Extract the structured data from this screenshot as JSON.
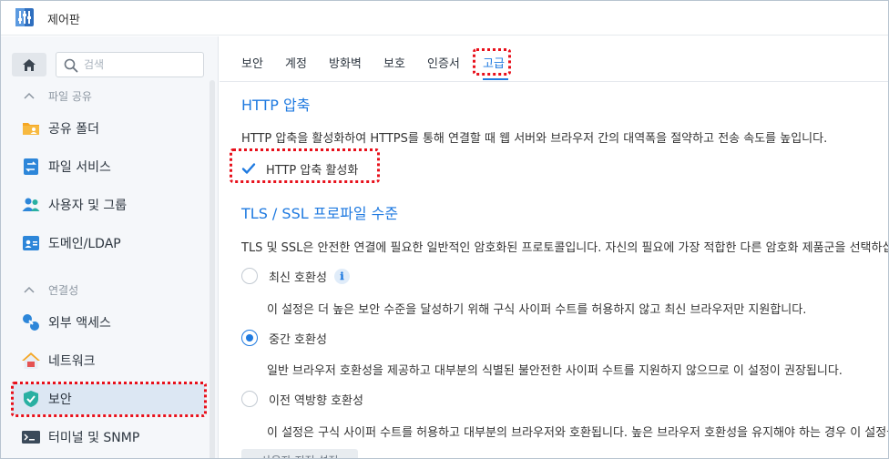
{
  "window": {
    "title": "제어판"
  },
  "sidebar": {
    "search_placeholder": "검색",
    "sections": [
      {
        "label": "파일 공유",
        "items": [
          {
            "label": "공유 폴더",
            "icon": "folder-share-icon"
          },
          {
            "label": "파일 서비스",
            "icon": "file-services-icon"
          },
          {
            "label": "사용자 및 그룹",
            "icon": "users-icon"
          },
          {
            "label": "도메인/LDAP",
            "icon": "domain-icon"
          }
        ]
      },
      {
        "label": "연결성",
        "items": [
          {
            "label": "외부 액세스",
            "icon": "external-access-icon"
          },
          {
            "label": "네트워크",
            "icon": "network-icon"
          },
          {
            "label": "보안",
            "icon": "security-shield-icon",
            "active": true
          },
          {
            "label": "터미널 및 SNMP",
            "icon": "terminal-icon"
          }
        ]
      }
    ]
  },
  "tabs": [
    {
      "label": "보안"
    },
    {
      "label": "계정"
    },
    {
      "label": "방화벽"
    },
    {
      "label": "보호"
    },
    {
      "label": "인증서"
    },
    {
      "label": "고급",
      "active": true
    }
  ],
  "http_compression": {
    "title": "HTTP 압축",
    "description": "HTTP 압축을 활성화하여 HTTPS를 통해 연결할 때 웹 서버와 브라우저 간의 대역폭을 절약하고 전송 속도를 높입니다.",
    "checkbox_label": "HTTP 압축 활성화",
    "checked": true
  },
  "tls_profile": {
    "title": "TLS / SSL 프로파일 수준",
    "description": "TLS 및 SSL은 안전한 연결에 필요한 일반적인 암호화된 프로토콜입니다. 자신의 필요에 가장 적합한 다른 암호화 제품군을 선택하십시오.",
    "options": [
      {
        "label": "최신 호환성",
        "info_icon": "ℹ",
        "selected": false,
        "description": "이 설정은 더 높은 보안 수준을 달성하기 위해 구식 사이퍼 수트를 허용하지 않고 최신 브라우저만 지원합니다."
      },
      {
        "label": "중간 호환성",
        "selected": true,
        "description": "일반 브라우저 호환성을 제공하고 대부분의 식별된 불안전한 사이퍼 수트를 지원하지 않으므로 이 설정이 권장됩니다."
      },
      {
        "label": "이전 역방향 호환성",
        "selected": false,
        "description": "이 설정은 구식 사이퍼 수트를 허용하고 대부분의 브라우저와 호환됩니다. 높은 브라우저 호환성을 유지해야 하는 경우 이 설정을 사용하십시오."
      }
    ],
    "custom_button": "사용자 지정 설정"
  },
  "colors": {
    "accent": "#1f7ae0",
    "highlight": "#e8101b",
    "active_nav": "#dce7f3"
  }
}
